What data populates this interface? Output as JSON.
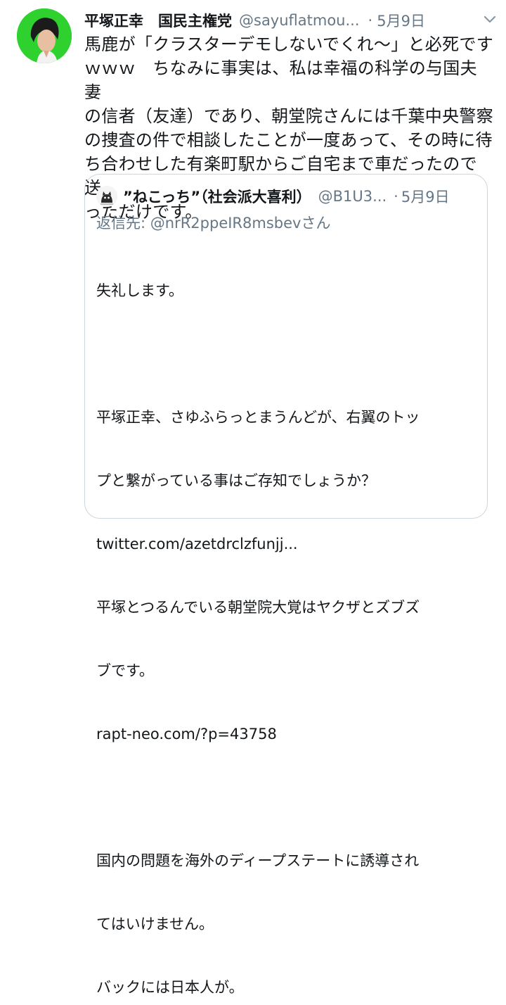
{
  "tweet": {
    "display_name": "平塚正幸　国民主権党",
    "handle": "@sayuflatmou...",
    "separator": "·",
    "date": "5月9日",
    "text": "馬鹿が「クラスターデモしないでくれ〜」と必死です\nｗｗｗ　ちなみに事実は、私は幸福の科学の与国夫妻\nの信者（友達）であり、朝堂院さんには千葉中央警察\nの捜査の件で相談したことが一度あって、その時に待\nち合わせした有楽町駅からご自宅まで車だったので送\nっただけです。"
  },
  "quoted": {
    "display_name": "”ねこっち”（社会派大喜利）",
    "handle": "@B1U3...",
    "separator": "·",
    "date": "5月9日",
    "reply_prefix": "返信先:",
    "reply_mention": "@nrR2ppeIR8msbevさん",
    "lines": [
      "失礼します。",
      "",
      "平塚正幸、さゆふらっとまうんどが、右翼のトッ",
      "プと繋がっている事はご存知でしょうか？",
      "twitter.com/azetdrclzfunjj...",
      "平塚とつるんでいる朝堂院大覚はヤクザとズブズ",
      "ブです。",
      "rapt-neo.com/?p=43758",
      "",
      "国内の問題を海外のディープステートに誘導され",
      "てはいけません。",
      "バックには日本人が。"
    ]
  },
  "icons": {
    "caret": "chevron-down-icon",
    "avatar_bg": "#2fd12f",
    "muted": "#657786",
    "border": "#ccd6dd"
  }
}
